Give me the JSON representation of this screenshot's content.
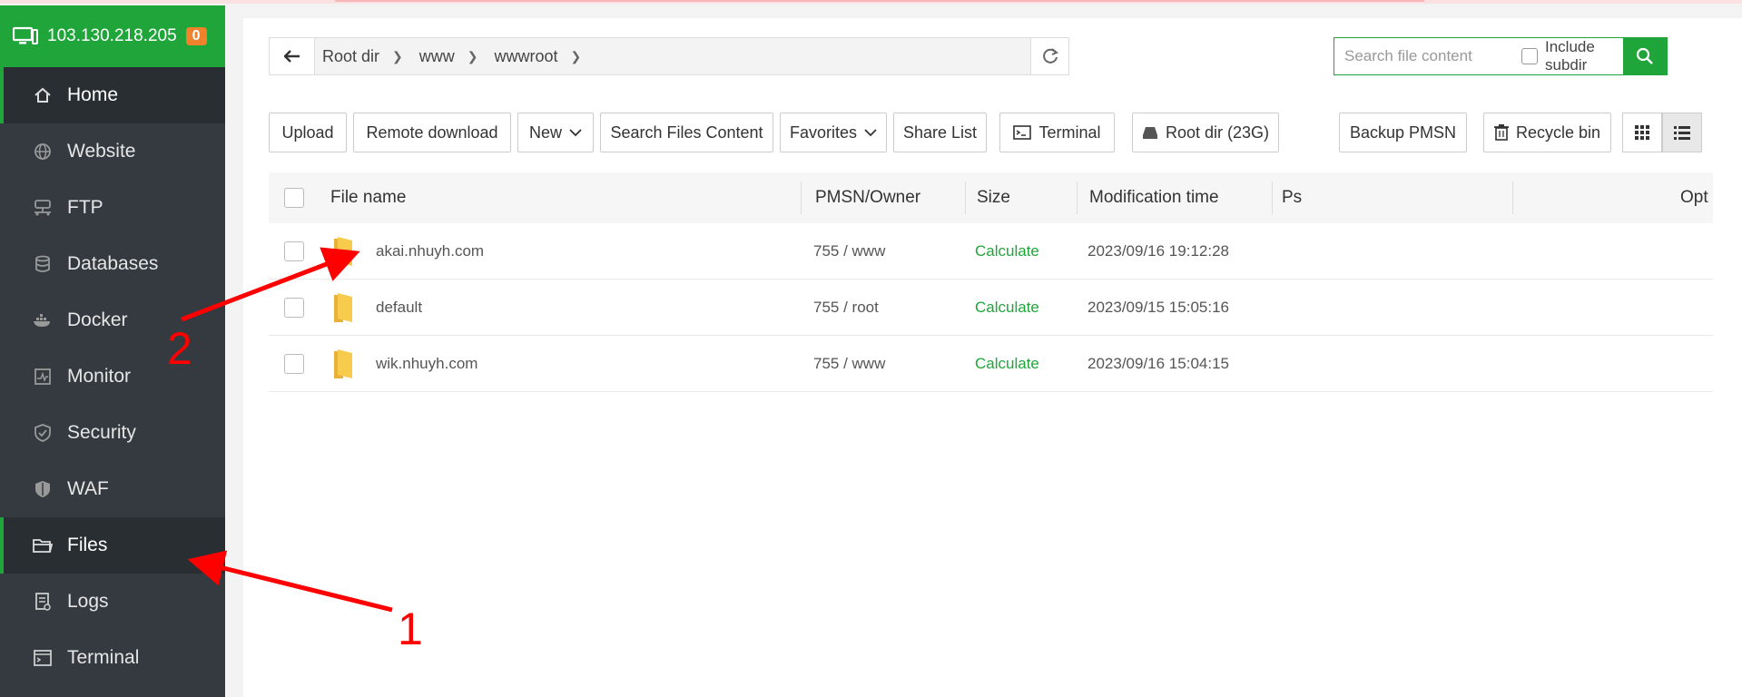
{
  "server": {
    "ip": "103.130.218.205",
    "badge": "0"
  },
  "sidebar": {
    "items": [
      {
        "label": "Home",
        "icon": "home-icon"
      },
      {
        "label": "Website",
        "icon": "globe-icon"
      },
      {
        "label": "FTP",
        "icon": "ftp-icon"
      },
      {
        "label": "Databases",
        "icon": "database-icon"
      },
      {
        "label": "Docker",
        "icon": "docker-icon"
      },
      {
        "label": "Monitor",
        "icon": "monitor-icon"
      },
      {
        "label": "Security",
        "icon": "shield-icon"
      },
      {
        "label": "WAF",
        "icon": "waf-icon"
      },
      {
        "label": "Files",
        "icon": "folder-icon"
      },
      {
        "label": "Logs",
        "icon": "logs-icon"
      },
      {
        "label": "Terminal",
        "icon": "terminal-icon"
      }
    ],
    "active": "Files"
  },
  "path": {
    "crumbs": [
      "Root dir",
      "www",
      "wwwroot"
    ]
  },
  "search": {
    "placeholder": "Search file content",
    "include_label": "Include subdir"
  },
  "toolbar": {
    "upload": "Upload",
    "remote_download": "Remote download",
    "new": "New",
    "search_files": "Search Files Content",
    "favorites": "Favorites",
    "share_list": "Share List",
    "terminal": "Terminal",
    "root_dir": "Root dir (23G)",
    "backup": "Backup PMSN",
    "recycle": "Recycle bin"
  },
  "table": {
    "headers": {
      "name": "File name",
      "perm": "PMSN/Owner",
      "size": "Size",
      "mtime": "Modification time",
      "ps": "Ps",
      "opt": "Opt"
    },
    "rows": [
      {
        "name": "akai.nhuyh.com",
        "perm": "755 / www",
        "size": "Calculate",
        "mtime": "2023/09/16 19:12:28"
      },
      {
        "name": "default",
        "perm": "755 / root",
        "size": "Calculate",
        "mtime": "2023/09/15 15:05:16"
      },
      {
        "name": "wik.nhuyh.com",
        "perm": "755 / www",
        "size": "Calculate",
        "mtime": "2023/09/16 15:04:15"
      }
    ]
  },
  "annotations": {
    "one": "1",
    "two": "2"
  },
  "colors": {
    "accent": "#20a53a",
    "sidebar": "#343a40",
    "badge": "#f0822b",
    "arrow": "#ff0000",
    "folder": "#f8cb4c"
  }
}
